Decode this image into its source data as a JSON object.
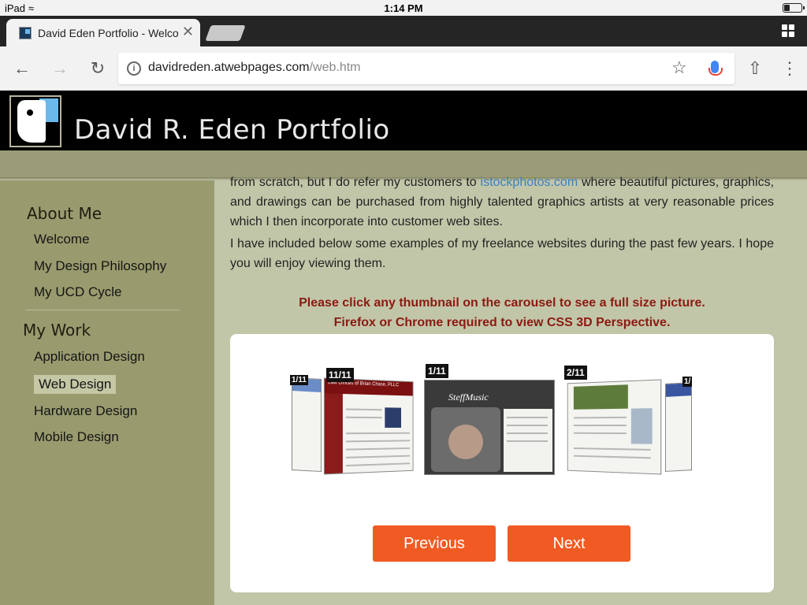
{
  "status_bar": {
    "device": "iPad",
    "time": "1:14 PM"
  },
  "browser": {
    "tab_title": "David Eden Portfolio - Welco",
    "url_host": "davidreden.atwebpages.com",
    "url_path": "/web.htm"
  },
  "site": {
    "title": "David R. Eden Portfolio"
  },
  "sidebar": {
    "sections": [
      {
        "heading": "About Me",
        "items": [
          "Welcome",
          "My Design Philosophy",
          "My UCD Cycle"
        ]
      },
      {
        "heading": "My Work",
        "items": [
          "Application Design",
          "Web Design",
          "Hardware Design",
          "Mobile Design"
        ]
      }
    ],
    "active_item": "Web Design"
  },
  "content": {
    "intro_lead": "from scratch, but I do refer my customers to",
    "intro_link": "istockphotos.com",
    "intro_rest": "where beautiful pictures, graphics, and drawings can be purchased from highly talented graphics artists at very reasonable prices which I then incorporate into customer web sites.",
    "paragraph_2": "I have included below some examples of my freelance websites during the past few years. I hope you will enjoy viewing them.",
    "notice_1": "Please click any thumbnail on the carousel to see a full size picture.",
    "notice_2": "Firefox or Chrome required to view CSS 3D Perspective."
  },
  "carousel": {
    "badges": [
      "11/11",
      "1/11",
      "2/11"
    ],
    "previous_label": "Previous",
    "next_label": "Next",
    "slide_1_header": "Law Offices of Brian Chase, PLLC",
    "slide_2_header": "SteffMusic"
  }
}
